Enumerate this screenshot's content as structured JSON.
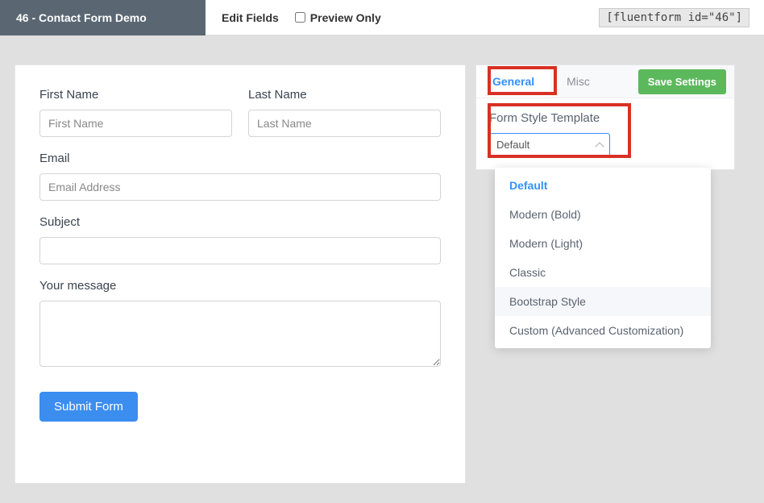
{
  "header": {
    "title": "46 - Contact Form Demo",
    "edit_fields": "Edit Fields",
    "preview_only": "Preview Only",
    "shortcode": "[fluentform id=\"46\"]"
  },
  "form": {
    "first_name": {
      "label": "First Name",
      "placeholder": "First Name"
    },
    "last_name": {
      "label": "Last Name",
      "placeholder": "Last Name"
    },
    "email": {
      "label": "Email",
      "placeholder": "Email Address"
    },
    "subject": {
      "label": "Subject",
      "placeholder": ""
    },
    "message": {
      "label": "Your message",
      "placeholder": ""
    },
    "submit": "Submit Form"
  },
  "settings": {
    "tabs": {
      "general": "General",
      "misc": "Misc"
    },
    "save": "Save Settings",
    "template_label": "Form Style Template",
    "template_selected": "Default",
    "template_options": [
      "Default",
      "Modern (Bold)",
      "Modern (Light)",
      "Classic",
      "Bootstrap Style",
      "Custom (Advanced Customization)"
    ]
  }
}
